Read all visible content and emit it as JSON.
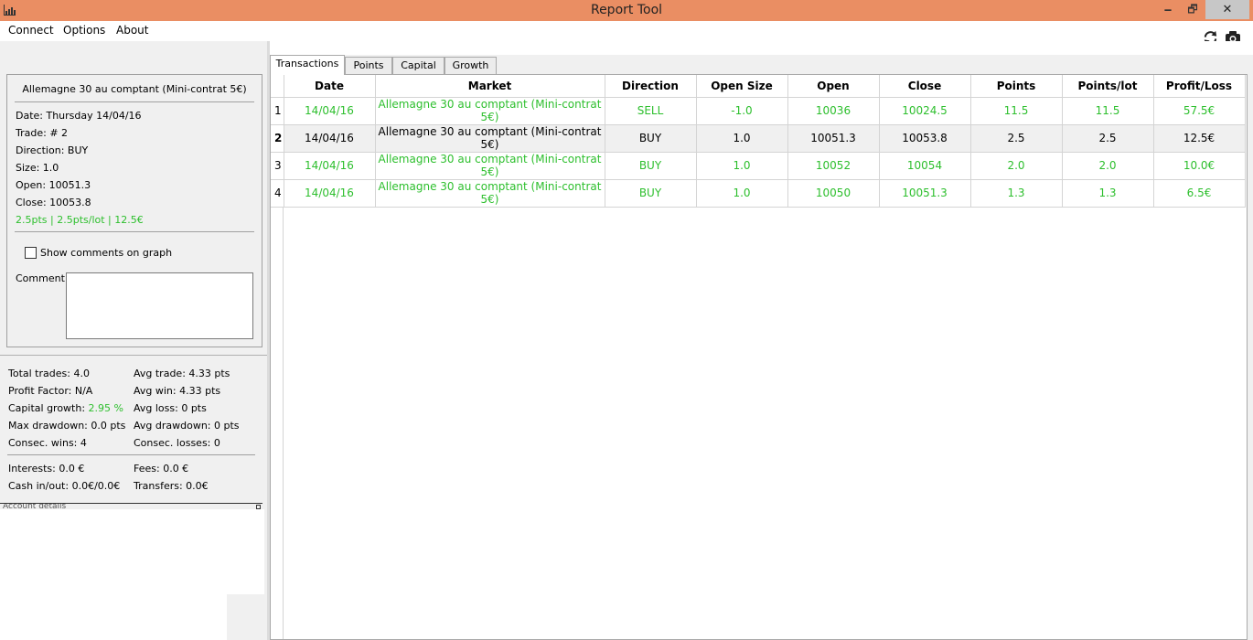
{
  "window": {
    "title": "Report Tool",
    "minimize": "🗕",
    "maximize": "🗗",
    "close": "✕"
  },
  "menu": {
    "items": [
      "Connect",
      "Options",
      "About"
    ]
  },
  "detail": {
    "title": "Allemagne 30 au comptant (Mini-contrat 5€)",
    "date": "Date: Thursday 14/04/16",
    "trade": "Trade: # 2",
    "direction": "Direction: BUY",
    "size": "Size: 1.0",
    "open": "Open: 10051.3",
    "close": "Close: 10053.8",
    "summary": "2.5pts | 2.5pts/lot | 12.5€",
    "show_comments_label": "Show comments on graph",
    "comment_label": "Comment:",
    "comment_value": ""
  },
  "stats": {
    "total_trades": "Total trades: 4.0",
    "profit_factor": "Profit Factor: N/A",
    "capital_growth_label": "Capital growth:",
    "capital_growth_value": "2.95 %",
    "max_drawdown": "Max drawdown: 0.0 pts",
    "consec_wins": "Consec. wins: 4",
    "avg_trade": "Avg trade: 4.33 pts",
    "avg_win": "Avg win: 4.33 pts",
    "avg_loss": "Avg loss: 0 pts",
    "avg_drawdown": "Avg drawdown: 0 pts",
    "consec_losses": "Consec. losses: 0",
    "interests": "Interests: 0.0 €",
    "cash_in_out": "Cash in/out: 0.0€/0.0€",
    "fees": "Fees: 0.0 €",
    "transfers": "Transfers: 0.0€"
  },
  "account_panel": {
    "title": "Account details"
  },
  "tabs": [
    "Transactions",
    "Points",
    "Capital",
    "Growth"
  ],
  "table": {
    "columns": [
      "Date",
      "Market",
      "Direction",
      "Open Size",
      "Open",
      "Close",
      "Points",
      "Points/lot",
      "Profit/Loss"
    ],
    "rows": [
      {
        "num": "1",
        "cells": [
          "14/04/16",
          "Allemagne 30 au comptant (Mini-contrat 5€)",
          "SELL",
          "-1.0",
          "10036",
          "10024.5",
          "11.5",
          "11.5",
          "57.5€"
        ]
      },
      {
        "num": "2",
        "cells": [
          "14/04/16",
          "Allemagne 30 au comptant (Mini-contrat 5€)",
          "BUY",
          "1.0",
          "10051.3",
          "10053.8",
          "2.5",
          "2.5",
          "12.5€"
        ]
      },
      {
        "num": "3",
        "cells": [
          "14/04/16",
          "Allemagne 30 au comptant (Mini-contrat 5€)",
          "BUY",
          "1.0",
          "10052",
          "10054",
          "2.0",
          "2.0",
          "10.0€"
        ]
      },
      {
        "num": "4",
        "cells": [
          "14/04/16",
          "Allemagne 30 au comptant (Mini-contrat 5€)",
          "BUY",
          "1.0",
          "10050",
          "10051.3",
          "1.3",
          "1.3",
          "6.5€"
        ]
      }
    ]
  },
  "colors": {
    "titlebar": "#ea8e63",
    "profit_green": "#2dbf2d"
  },
  "icons": {
    "app": "chart-icon",
    "refresh": "refresh-icon",
    "screenshot": "camera-icon"
  }
}
